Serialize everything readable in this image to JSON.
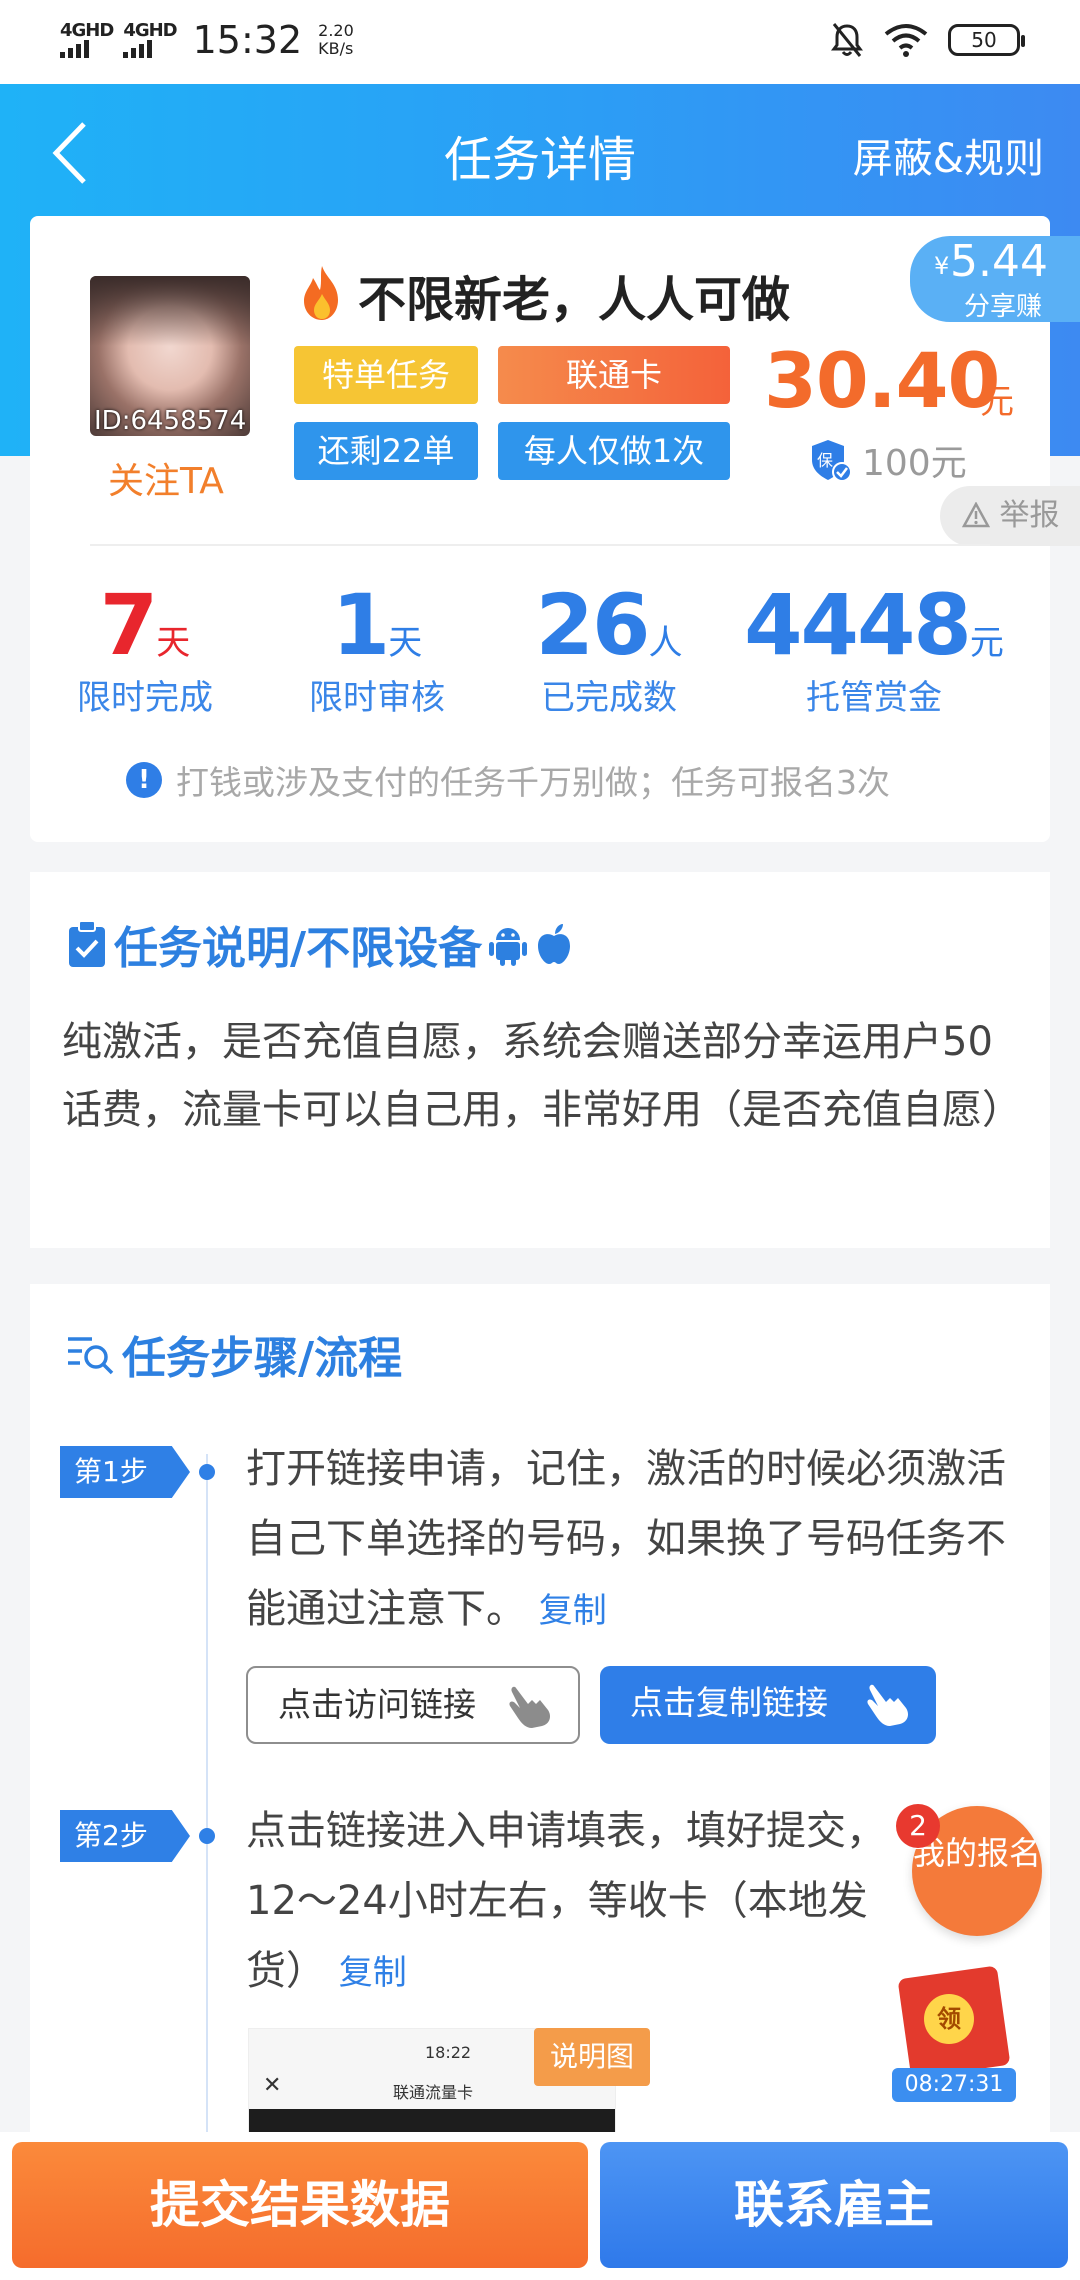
{
  "status_bar": {
    "signal1": "4GHD",
    "signal2": "4GHD",
    "time": "15:32",
    "speed_value": "2.20",
    "speed_unit": "KB/s",
    "battery": "50"
  },
  "header": {
    "title": "任务详情",
    "rules": "屏蔽&规则"
  },
  "task": {
    "user_id": "ID:6458574",
    "follow": "关注TA",
    "name": "不限新老，人人可做",
    "tags": [
      "特单任务",
      "联通卡",
      "还剩22单",
      "每人仅做1次"
    ],
    "price": "30.40",
    "price_unit": "元",
    "deposit": "100元",
    "share_amount": "5.44",
    "share_currency": "¥",
    "share_label": "分享赚",
    "report": "举报",
    "stats": [
      {
        "num": "7",
        "unit": "天",
        "label": "限时完成",
        "color": "#e8262d"
      },
      {
        "num": "1",
        "unit": "天",
        "label": "限时审核",
        "color": "#2f7ee6"
      },
      {
        "num": "26",
        "unit": "人",
        "label": "已完成数",
        "color": "#2f7ee6"
      },
      {
        "num": "4448",
        "unit": "元",
        "label": "托管赏金",
        "color": "#2f7ee6"
      }
    ],
    "warning": "打钱或涉及支付的任务千万别做；任务可报名3次"
  },
  "description": {
    "title": "任务说明/不限设备",
    "text": "纯激活，是否充值自愿，系统会赠送部分幸运用户50话费，流量卡可以自己用，非常好用（是否充值自愿）"
  },
  "steps": {
    "title": "任务步骤/流程",
    "items": [
      {
        "badge": "第1步",
        "text": "打开链接申请，记住，激活的时候必须激活自己下单选择的号码，如果换了号码任务不能通过注意下。",
        "copy": "复制"
      },
      {
        "badge": "第2步",
        "text": "点击链接进入申请填表，填好提交，12～24小时左右，等收卡（本地发货）",
        "copy": "复制"
      }
    ],
    "visit_button": "点击访问链接",
    "copy_button": "点击复制链接",
    "thumb_tag": "说明图",
    "thumb_time": "18:22",
    "thumb_title": "联通流量卡"
  },
  "floating": {
    "my_signup": "我的报名",
    "signup_count": "2",
    "redpack_label": "领",
    "timer": "08:27:31"
  },
  "bottom": {
    "submit": "提交结果数据",
    "contact": "联系雇主"
  }
}
